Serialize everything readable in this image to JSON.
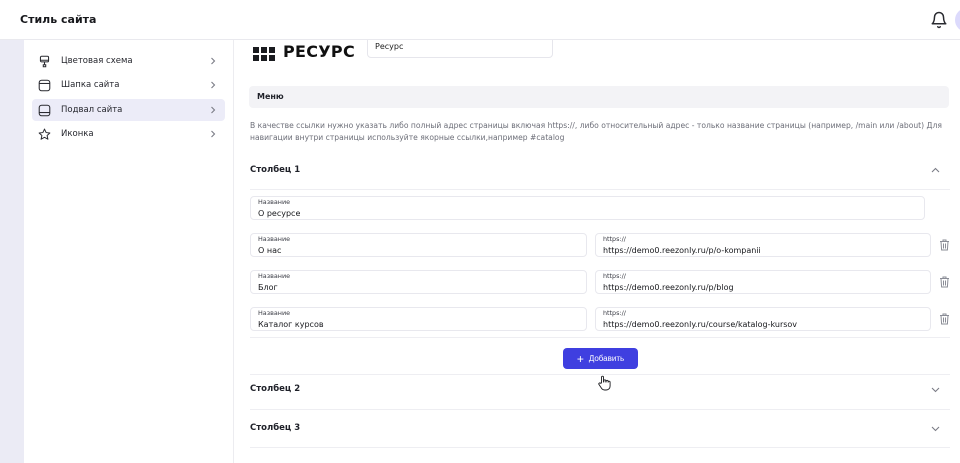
{
  "header": {
    "title": "Стиль сайта",
    "bell_icon": "bell-icon"
  },
  "sidebar": {
    "items": [
      {
        "label": "Цветовая схема",
        "icon": "palette-icon"
      },
      {
        "label": "Шапка сайта",
        "icon": "header-layout-icon"
      },
      {
        "label": "Подвал сайта",
        "icon": "footer-layout-icon",
        "active": true
      },
      {
        "label": "Иконка",
        "icon": "star-icon"
      }
    ]
  },
  "logo": {
    "text": "РЕСУРС"
  },
  "site_name": {
    "value": "Ресурс"
  },
  "menu": {
    "title": "Меню",
    "hint": "В качестве ссылки нужно указать либо полный адрес страницы включая https://, либо относительный адрес - только название страницы (например, /main или /about) Для навигации внутри страницы используйте якорные ссылки,например #catalog"
  },
  "columns": [
    {
      "title": "Столбец 1",
      "name_label": "Название",
      "name_value": "О ресурсе",
      "links": [
        {
          "name_label": "Название",
          "name": "О нас",
          "url_label": "https://",
          "url": "https://demo0.reezonly.ru/p/o-kompanii"
        },
        {
          "name_label": "Название",
          "name": "Блог",
          "url_label": "https://",
          "url": "https://demo0.reezonly.ru/p/blog"
        },
        {
          "name_label": "Название",
          "name": "Каталог курсов",
          "url_label": "https://",
          "url": "https://demo0.reezonly.ru/course/katalog-kursov"
        }
      ],
      "add_label": "Добавить"
    },
    {
      "title": "Столбец 2"
    },
    {
      "title": "Столбец 3"
    }
  ],
  "colors": {
    "accent": "#3f3fe0",
    "active_bg": "#ececf8"
  }
}
